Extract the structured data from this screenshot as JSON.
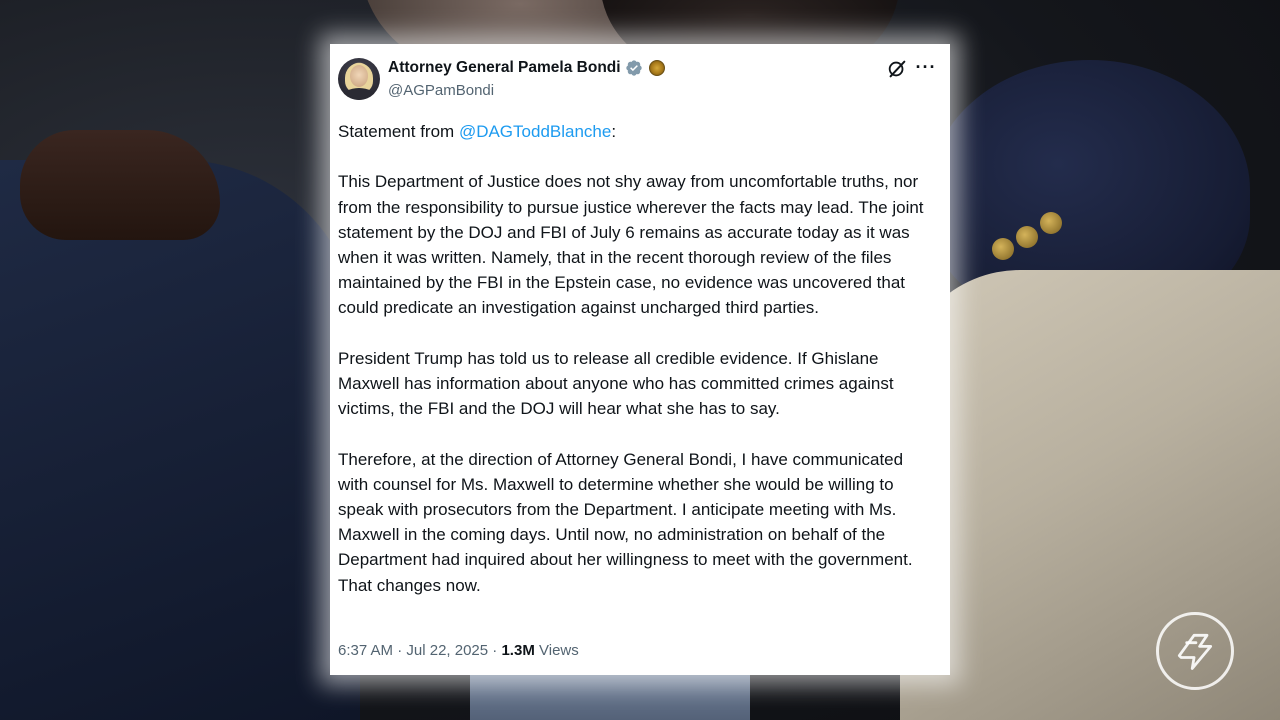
{
  "tweet": {
    "display_name": "Attorney General Pamela Bondi",
    "handle": "@AGPamBondi",
    "intro_prefix": "Statement from ",
    "mention": "@DAGToddBlanche",
    "intro_suffix": ":",
    "paragraphs": [
      "This Department of Justice does not shy away from uncomfortable truths, nor from the responsibility to pursue justice wherever the facts may lead.  The joint statement by the DOJ and FBI of July 6 remains as accurate today as it was when it was written.  Namely, that in the recent thorough review of the files maintained by the FBI in the Epstein case, no evidence was uncovered that could predicate an investigation against uncharged third parties.",
      "President Trump has told us to release all credible evidence. If Ghislane Maxwell has information about anyone who has committed crimes against victims, the FBI and the DOJ will hear what she has to say.",
      "Therefore, at the direction of Attorney General Bondi, I have communicated with counsel for Ms. Maxwell to determine whether she would be willing to speak with prosecutors from the Department.  I anticipate meeting with Ms. Maxwell in the coming days.  Until now, no administration on behalf of the Department had inquired about her willingness to meet with the government.  That changes now."
    ],
    "time": "6:37 AM",
    "separator": "·",
    "date": "Jul 22, 2025",
    "views_count": "1.3M",
    "views_label": "Views"
  },
  "icons": {
    "verified": "verified-badge-icon",
    "affiliate": "government-seal-icon",
    "grok": "grok-icon",
    "more": "more-icon",
    "logo": "channel-logo-icon"
  },
  "colors": {
    "mention": "#1d9bf0",
    "verified": "#829aab",
    "text": "#0f1419",
    "secondary": "#536471"
  }
}
